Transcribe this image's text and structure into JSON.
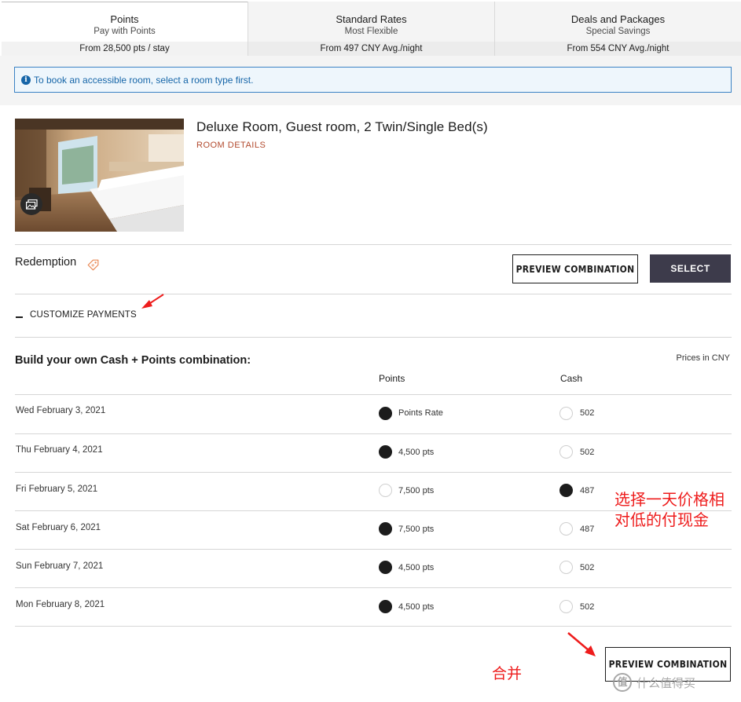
{
  "tabs": [
    {
      "title": "Points",
      "subtitle": "Pay with Points",
      "price": "From 28,500 pts / stay",
      "active": true
    },
    {
      "title": "Standard Rates",
      "subtitle": "Most Flexible",
      "price": "From 497 CNY Avg./night",
      "active": false
    },
    {
      "title": "Deals and Packages",
      "subtitle": "Special Savings",
      "price": "From 554 CNY Avg./night",
      "active": false
    }
  ],
  "notice": {
    "icon": "info-icon",
    "text": "To book an accessible room, select a room type first."
  },
  "room": {
    "title": "Deluxe Room, Guest room, 2 Twin/Single Bed(s)",
    "details_link": "ROOM DETAILS",
    "photo_icon": "photo-gallery-icon"
  },
  "redemption": {
    "label": "Redemption",
    "tag_icon": "price-tag-icon"
  },
  "buttons": {
    "preview": "PREVIEW COMBINATION",
    "select": "SELECT",
    "preview_bottom": "PREVIEW COMBINATION"
  },
  "customize": {
    "label": "CUSTOMIZE PAYMENTS"
  },
  "builder": {
    "title": "Build your own Cash + Points combination:",
    "prices_in": "Prices in CNY",
    "points_header": "Points",
    "cash_header": "Cash",
    "rows": [
      {
        "date": "Wed February 3, 2021",
        "points": "Points Rate",
        "cash": "502",
        "selected": "points"
      },
      {
        "date": "Thu February 4, 2021",
        "points": "4,500 pts",
        "cash": "502",
        "selected": "points"
      },
      {
        "date": "Fri February 5, 2021",
        "points": "7,500 pts",
        "cash": "487",
        "selected": "cash"
      },
      {
        "date": "Sat February 6, 2021",
        "points": "7,500 pts",
        "cash": "487",
        "selected": "points"
      },
      {
        "date": "Sun February 7, 2021",
        "points": "4,500 pts",
        "cash": "502",
        "selected": "points"
      },
      {
        "date": "Mon February 8, 2021",
        "points": "4,500 pts",
        "cash": "502",
        "selected": "points"
      }
    ]
  },
  "annotations": {
    "note_line1": "选择一天价格相",
    "note_line2": "对低的付现金",
    "merge": "合并",
    "arrow_color": "#ee1c1c"
  },
  "watermark": {
    "glyph": "值",
    "text": "什么值得买"
  }
}
